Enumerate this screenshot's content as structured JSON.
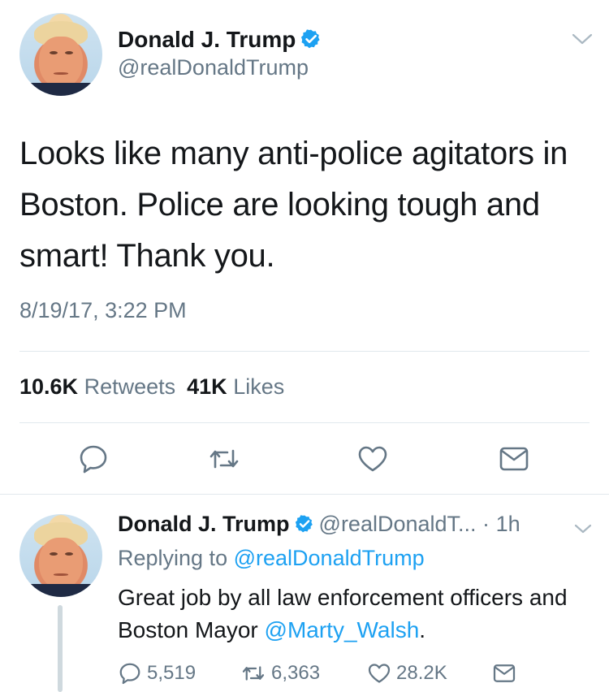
{
  "main_tweet": {
    "display_name": "Donald J. Trump",
    "handle": "@realDonaldTrump",
    "text": "Looks like many anti-police agitators in Boston. Police are looking tough and smart! Thank you.",
    "timestamp": "8/19/17, 3:22 PM",
    "retweets_count": "10.6K",
    "retweets_label": "Retweets",
    "likes_count": "41K",
    "likes_label": "Likes",
    "actions": [
      "reply-icon",
      "retweet-icon",
      "like-icon",
      "direct-message-icon"
    ]
  },
  "reply_tweet": {
    "display_name": "Donald J. Trump",
    "handle_truncated": "@realDonaldT...",
    "separator": "·",
    "time_ago": "1h",
    "replying_prefix": "Replying to",
    "replying_handle": "@realDonaldTrump",
    "text_before_mention": "Great job by all law enforcement officers and Boston Mayor ",
    "mention": "@Marty_Walsh",
    "text_after_mention": ".",
    "reply_count": "5,519",
    "retweet_count": "6,363",
    "like_count": "28.2K"
  },
  "colors": {
    "accent": "#1da1f2",
    "muted": "#657786",
    "text": "#14171a",
    "divider": "#e1e8ed",
    "verified": "#1da1f2"
  }
}
